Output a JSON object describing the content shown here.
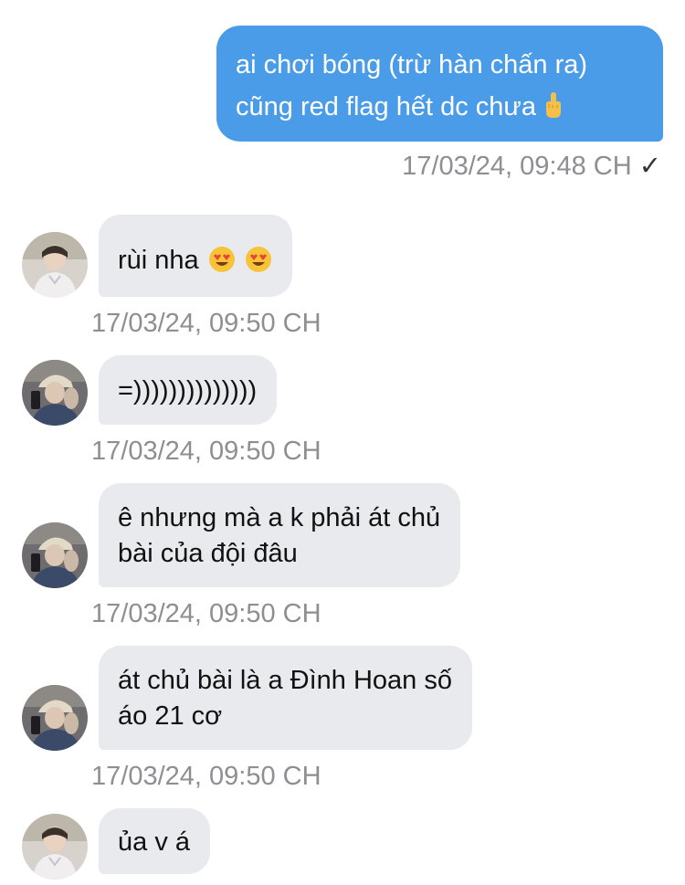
{
  "outgoing": {
    "lines": [
      "ai chơi bóng (trừ hàn chấn ra)",
      "cũng red flag hết dc chưa"
    ],
    "emoji": "middle-finger-emoji",
    "timestamp": "17/03/24, 09:48 CH",
    "status": "✓"
  },
  "incoming": [
    {
      "avatar": "avatar-light",
      "lines": [
        "rùi nha"
      ],
      "emojis": [
        "heart-eyes-emoji",
        "heart-eyes-emoji"
      ],
      "timestamp": "17/03/24, 09:50 CH"
    },
    {
      "avatar": "avatar-cap",
      "lines": [
        "=))))))))))))))"
      ],
      "timestamp": "17/03/24, 09:50 CH"
    },
    {
      "avatar": "avatar-cap",
      "lines": [
        "ê nhưng mà a k phải át chủ",
        "bài của đội đâu"
      ],
      "timestamp": "17/03/24, 09:50 CH"
    },
    {
      "avatar": "avatar-cap",
      "lines": [
        "át chủ bài là a Đình Hoan số",
        "áo 21 cơ"
      ],
      "timestamp": "17/03/24, 09:50 CH"
    },
    {
      "avatar": "avatar-light",
      "lines": [
        "ủa v á"
      ]
    }
  ],
  "colors": {
    "outgoing_bubble": "#4a9be8",
    "incoming_bubble": "#e8eaee",
    "timestamp": "#8e8e93"
  }
}
